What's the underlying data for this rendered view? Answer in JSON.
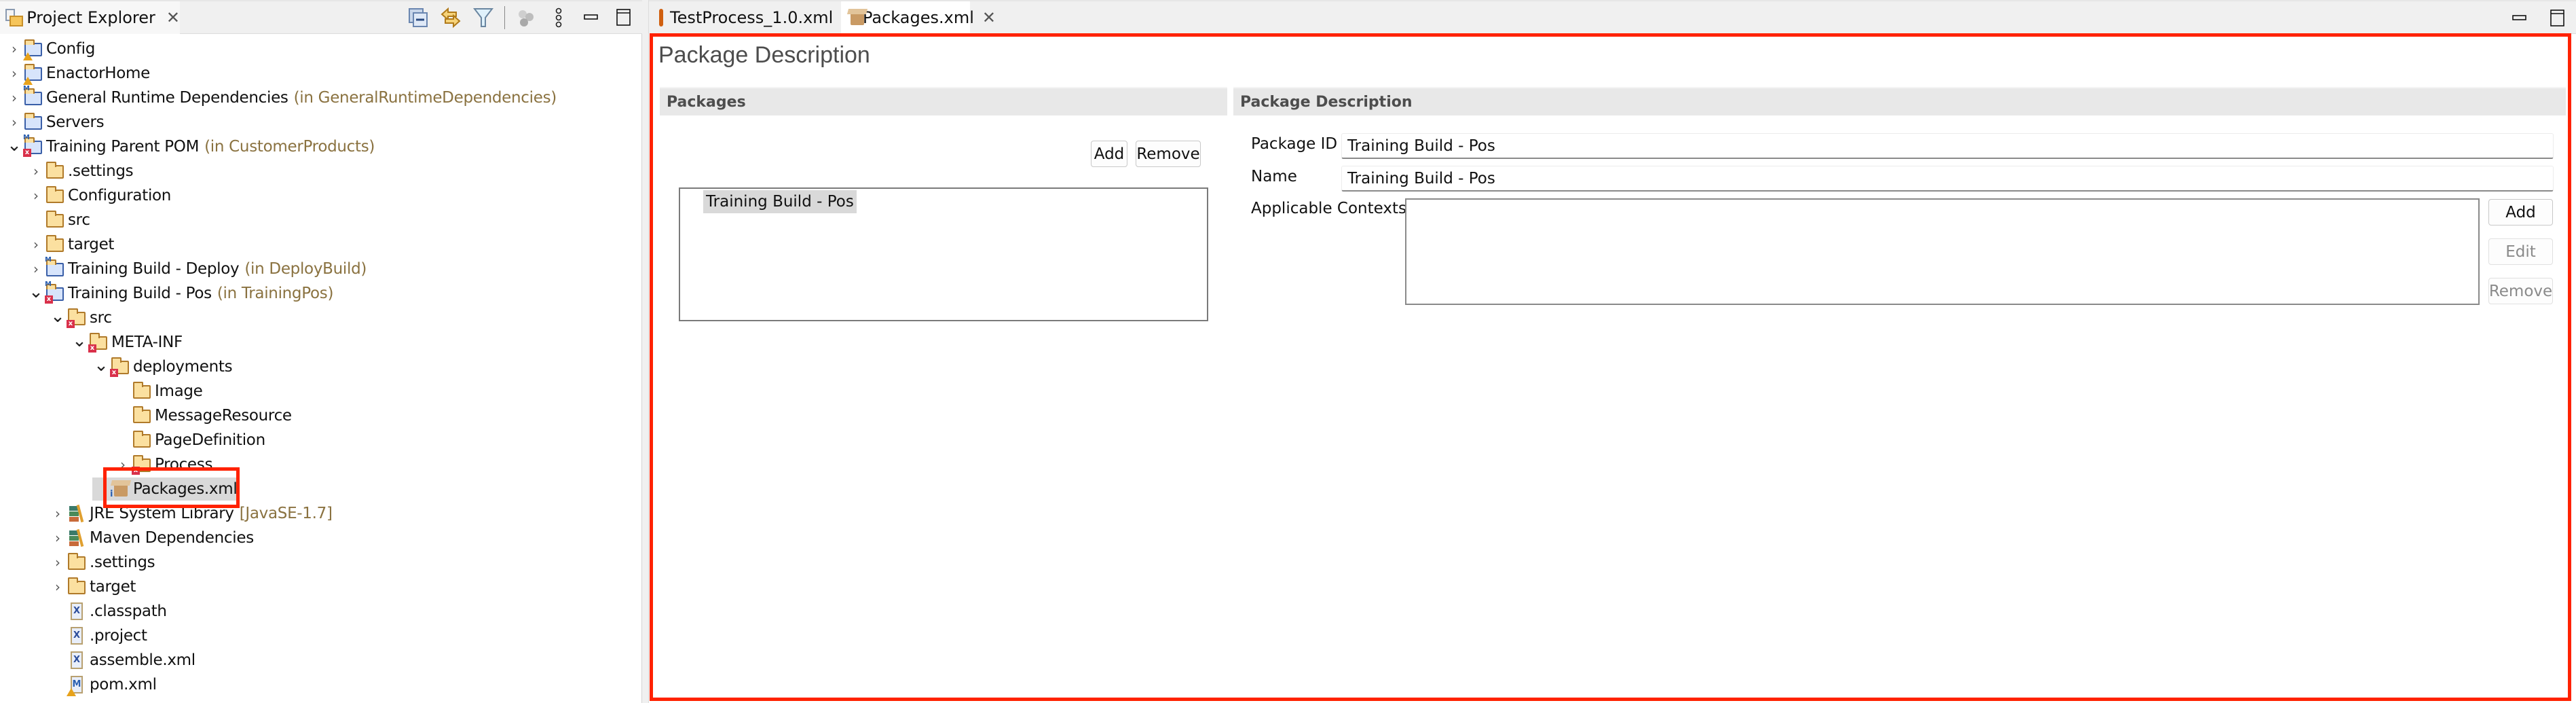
{
  "left_panel": {
    "tab_label": "Project Explorer",
    "tools": [
      "collapse-all-icon",
      "link-with-editor-icon",
      "filter-icon",
      "working-sets-icon",
      "view-menu-icon",
      "minimize-icon",
      "maximize-icon"
    ]
  },
  "tree": [
    {
      "label": "Config",
      "deco": "",
      "depth": 0,
      "twisty": "collapsed",
      "icon": "project-folder-warning"
    },
    {
      "label": "EnactorHome",
      "deco": "",
      "depth": 0,
      "twisty": "collapsed",
      "icon": "project-folder-warning"
    },
    {
      "label": "General Runtime Dependencies",
      "deco": "(in GeneralRuntimeDependencies)",
      "depth": 0,
      "twisty": "collapsed",
      "icon": "maven-project"
    },
    {
      "label": "Servers",
      "deco": "",
      "depth": 0,
      "twisty": "collapsed",
      "icon": "project-folder"
    },
    {
      "label": "Training Parent POM",
      "deco": "(in CustomerProducts)",
      "depth": 0,
      "twisty": "expanded",
      "icon": "maven-project-error"
    },
    {
      "label": ".settings",
      "deco": "",
      "depth": 1,
      "twisty": "collapsed",
      "icon": "folder"
    },
    {
      "label": "Configuration",
      "deco": "",
      "depth": 1,
      "twisty": "collapsed",
      "icon": "folder"
    },
    {
      "label": "src",
      "deco": "",
      "depth": 1,
      "twisty": "none",
      "icon": "folder"
    },
    {
      "label": "target",
      "deco": "",
      "depth": 1,
      "twisty": "collapsed",
      "icon": "folder"
    },
    {
      "label": "Training Build - Deploy",
      "deco": "(in DeployBuild)",
      "depth": 1,
      "twisty": "collapsed",
      "icon": "maven-project"
    },
    {
      "label": "Training Build - Pos",
      "deco": "(in TrainingPos)",
      "depth": 1,
      "twisty": "expanded",
      "icon": "maven-project-error"
    },
    {
      "label": "src",
      "deco": "",
      "depth": 2,
      "twisty": "expanded",
      "icon": "source-folder-error"
    },
    {
      "label": "META-INF",
      "deco": "",
      "depth": 3,
      "twisty": "expanded",
      "icon": "folder-error"
    },
    {
      "label": "deployments",
      "deco": "",
      "depth": 4,
      "twisty": "expanded",
      "icon": "folder-error"
    },
    {
      "label": "Image",
      "deco": "",
      "depth": 5,
      "twisty": "none",
      "icon": "folder"
    },
    {
      "label": "MessageResource",
      "deco": "",
      "depth": 5,
      "twisty": "none",
      "icon": "folder"
    },
    {
      "label": "PageDefinition",
      "deco": "",
      "depth": 5,
      "twisty": "none",
      "icon": "folder"
    },
    {
      "label": "Process",
      "deco": "",
      "depth": 5,
      "twisty": "collapsed",
      "icon": "folder-error"
    },
    {
      "label": "Packages.xml",
      "deco": "",
      "depth": 4,
      "twisty": "none",
      "icon": "package-file",
      "selected": true
    },
    {
      "label": "JRE System Library",
      "deco": "[JavaSE-1.7]",
      "depth": 2,
      "twisty": "collapsed",
      "icon": "library"
    },
    {
      "label": "Maven Dependencies",
      "deco": "",
      "depth": 2,
      "twisty": "collapsed",
      "icon": "library"
    },
    {
      "label": ".settings",
      "deco": "",
      "depth": 2,
      "twisty": "collapsed",
      "icon": "folder"
    },
    {
      "label": "target",
      "deco": "",
      "depth": 2,
      "twisty": "collapsed",
      "icon": "folder"
    },
    {
      "label": ".classpath",
      "deco": "",
      "depth": 2,
      "twisty": "none",
      "icon": "xml-file"
    },
    {
      "label": ".project",
      "deco": "",
      "depth": 2,
      "twisty": "none",
      "icon": "xml-file"
    },
    {
      "label": "assemble.xml",
      "deco": "",
      "depth": 2,
      "twisty": "none",
      "icon": "xml-file"
    },
    {
      "label": "pom.xml",
      "deco": "",
      "depth": 2,
      "twisty": "none",
      "icon": "pom-file-warning"
    }
  ],
  "editor": {
    "tabs": [
      {
        "label": "TestProcess_1.0.xml",
        "icon": "process-file-icon",
        "active": false
      },
      {
        "label": "*Packages.xml",
        "icon": "package-file-icon",
        "active": true,
        "closable": true
      }
    ],
    "form_title": "Package Description",
    "packages_section": {
      "title": "Packages",
      "add_label": "Add",
      "remove_label": "Remove",
      "items": [
        "Training Build - Pos"
      ],
      "selected_item": "Training Build - Pos"
    },
    "description_section": {
      "title": "Package Description",
      "package_id_label": "Package ID",
      "package_id_value": "Training Build - Pos",
      "name_label": "Name",
      "name_value": "Training Build - Pos",
      "contexts_label": "Applicable Contexts",
      "contexts": [],
      "add_label": "Add",
      "edit_label": "Edit",
      "remove_label": "Remove"
    }
  },
  "colors": {
    "highlight": "#ff2200",
    "decoration_text": "#8a7240",
    "section_header_bg": "#e8e8e8",
    "selection_bg": "#d9d9d9"
  }
}
